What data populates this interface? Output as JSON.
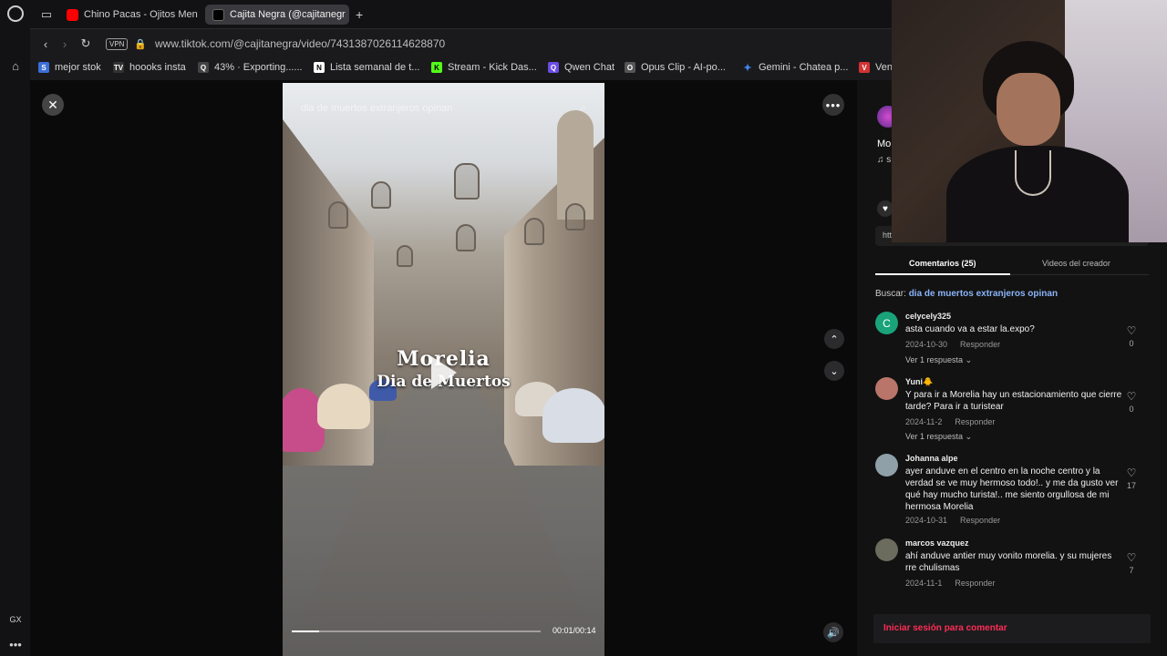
{
  "sidebar": {
    "logo_icon": "opera-logo-icon",
    "gx_label": "GX",
    "more_label": "•••"
  },
  "tabs": [
    {
      "label": "Chino Pacas - Ojitos Ment",
      "icon": "youtube-icon",
      "color": "#ff0000"
    },
    {
      "label": "Cajita Negra (@cajitanegr",
      "icon": "tiktok-icon",
      "color": "#000000"
    }
  ],
  "new_tab_label": "+",
  "address": {
    "vpn_label": "VPN",
    "url": "www.tiktok.com/@cajitanegra/video/7431387026114628870"
  },
  "bookmarks": [
    {
      "label": "mejor stok",
      "badge": "S",
      "color": "#3b6ed8"
    },
    {
      "label": "hoooks insta",
      "badge": "TV",
      "color": "#333333"
    },
    {
      "label": "43% · Exporting......",
      "badge": "Q",
      "color": "#444444"
    },
    {
      "label": "Lista semanal de t...",
      "badge": "N",
      "color": "#ffffff"
    },
    {
      "label": "Stream - Kick Das...",
      "badge": "K",
      "color": "#53fc18"
    },
    {
      "label": "Qwen Chat",
      "badge": "Q",
      "color": "#6b4ce6"
    },
    {
      "label": "Opus Clip - AI-po...",
      "badge": "O",
      "color": "#555555"
    },
    {
      "label": "Gemini - Chatea p...",
      "badge": "✦",
      "color": "#4285f4"
    },
    {
      "label": "Ven",
      "badge": "V",
      "color": "#d33333"
    }
  ],
  "video": {
    "search_overlay": "dia de muertos extranjeros opinan",
    "title_line1": "Morelia",
    "title_line2": "Dia de Muertos",
    "time": "00:01/00:14",
    "progress": 0.11
  },
  "panel": {
    "creator_name": "Mor",
    "music_prefix": "♫ s",
    "link_text": "htt",
    "tabs": {
      "comments": "Comentarios (25)",
      "creator_videos": "Videos del creador"
    },
    "search": {
      "label": "Buscar:",
      "query": "dia de muertos extranjeros opinan"
    },
    "comments": [
      {
        "user": "celycely325",
        "text": "asta cuando va a estar la.expo?",
        "date": "2024-10-30",
        "reply": "Responder",
        "likes": "0",
        "replies": "Ver 1 respuesta",
        "avatar_letter": "C",
        "avatar_color": "#1aa37a"
      },
      {
        "user": "Yuni🐥",
        "text": "Y para ir a Morelia hay un estacionamiento que cierre tarde? Para ir a turistear",
        "date": "2024-11-2",
        "reply": "Responder",
        "likes": "0",
        "replies": "Ver 1 respuesta",
        "avatar_letter": "",
        "avatar_color": "#b9756a"
      },
      {
        "user": "Johanna alpe",
        "text": "ayer anduve en el centro en la noche centro y la verdad se ve muy hermoso todo!.. y me da gusto ver qué hay mucho turista!.. me siento orgullosa de mi hermosa Morelia",
        "date": "2024-10-31",
        "reply": "Responder",
        "likes": "17",
        "replies": "",
        "avatar_letter": "",
        "avatar_color": "#8fa0a8"
      },
      {
        "user": "marcos vazquez",
        "text": "ahí anduve antier muy vonito morelia. y su mujeres rre chulismas",
        "date": "2024-11-1",
        "reply": "Responder",
        "likes": "7",
        "replies": "",
        "avatar_letter": "",
        "avatar_color": "#6b6b5e"
      }
    ],
    "login_prompt": "Iniciar sesión para comentar"
  },
  "colors": {
    "tiktok_red": "#fe2c55",
    "link_blue": "#8ab4f8"
  }
}
